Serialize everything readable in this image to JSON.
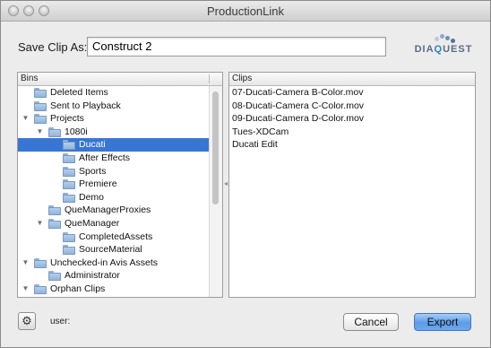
{
  "window": {
    "title": "ProductionLink"
  },
  "save": {
    "label": "Save Clip As:",
    "value": "Construct 2"
  },
  "logo": {
    "text_a": "DIA",
    "text_q": "Q",
    "text_b": "UEST"
  },
  "bins": {
    "header": "Bins",
    "rows": [
      {
        "label": "Deleted Items",
        "depth": 0,
        "toggle": ""
      },
      {
        "label": "Sent to Playback",
        "depth": 0,
        "toggle": ""
      },
      {
        "label": "Projects",
        "depth": 0,
        "toggle": "▼"
      },
      {
        "label": "1080i",
        "depth": 1,
        "toggle": "▼"
      },
      {
        "label": "Ducati",
        "depth": 2,
        "toggle": "",
        "selected": true
      },
      {
        "label": "After Effects",
        "depth": 2,
        "toggle": ""
      },
      {
        "label": "Sports",
        "depth": 2,
        "toggle": ""
      },
      {
        "label": "Premiere",
        "depth": 2,
        "toggle": ""
      },
      {
        "label": "Demo",
        "depth": 2,
        "toggle": ""
      },
      {
        "label": "QueManagerProxies",
        "depth": 1,
        "toggle": ""
      },
      {
        "label": "QueManager",
        "depth": 1,
        "toggle": "▼"
      },
      {
        "label": "CompletedAssets",
        "depth": 2,
        "toggle": ""
      },
      {
        "label": "SourceMaterial",
        "depth": 2,
        "toggle": ""
      },
      {
        "label": "Unchecked-in Avis Assets",
        "depth": 0,
        "toggle": "▼"
      },
      {
        "label": "Administrator",
        "depth": 1,
        "toggle": ""
      },
      {
        "label": "Orphan Clips",
        "depth": 0,
        "toggle": "▼"
      },
      {
        "label": "",
        "depth": 1,
        "toggle": ""
      }
    ]
  },
  "clips": {
    "header": "Clips",
    "items": [
      "07-Ducati-Camera B-Color.mov",
      "08-Ducati-Camera C-Color.mov",
      "09-Ducati-Camera D-Color.mov",
      "Tues-XDCam",
      "Ducati Edit"
    ]
  },
  "footer": {
    "gear_icon": "gear-icon",
    "user_label": "user:",
    "cancel_label": "Cancel",
    "export_label": "Export"
  },
  "colors": {
    "selection": "#3876d5",
    "accent": "#5c9be8",
    "logo_blue": "#2b7fc2"
  }
}
